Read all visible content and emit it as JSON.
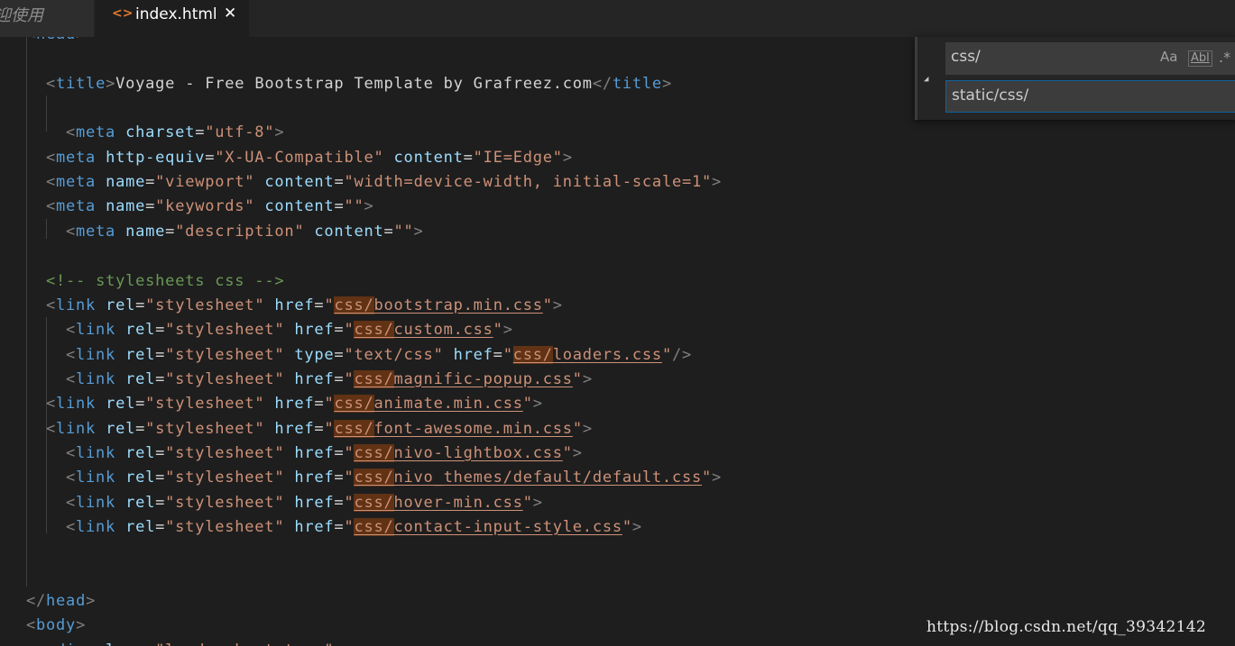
{
  "tabs": {
    "previous_label": "迎使用",
    "active": {
      "icon": "html-file-icon",
      "label": "index.html",
      "close_glyph": "✕"
    }
  },
  "colors": {
    "tag": "#569cd6",
    "attribute": "#9cdcfe",
    "string": "#ce9178",
    "comment": "#6a9955",
    "punctuation": "#808080",
    "find_match": "#613214"
  },
  "editor_lines": [
    [
      [
        "punc",
        "<"
      ],
      [
        "tag",
        "head"
      ],
      [
        "punc",
        ">"
      ]
    ],
    [],
    [
      [
        "punc",
        "<"
      ],
      [
        "tag",
        "title"
      ],
      [
        "punc",
        ">"
      ],
      [
        "plain",
        "Voyage - Free Bootstrap Template by Grafreez.com"
      ],
      [
        "punc",
        "</"
      ],
      [
        "tag",
        "title"
      ],
      [
        "punc",
        ">"
      ]
    ],
    [],
    [
      [
        "punc",
        "<"
      ],
      [
        "tag",
        "meta"
      ],
      [
        "plain",
        " "
      ],
      [
        "attr",
        "charset"
      ],
      [
        "plain",
        "="
      ],
      [
        "str",
        "\"utf-8\""
      ],
      [
        "punc",
        ">"
      ]
    ],
    [
      [
        "punc",
        "<"
      ],
      [
        "tag",
        "meta"
      ],
      [
        "plain",
        " "
      ],
      [
        "attr",
        "http-equiv"
      ],
      [
        "plain",
        "="
      ],
      [
        "str",
        "\"X-UA-Compatible\""
      ],
      [
        "plain",
        " "
      ],
      [
        "attr",
        "content"
      ],
      [
        "plain",
        "="
      ],
      [
        "str",
        "\"IE=Edge\""
      ],
      [
        "punc",
        ">"
      ]
    ],
    [
      [
        "punc",
        "<"
      ],
      [
        "tag",
        "meta"
      ],
      [
        "plain",
        " "
      ],
      [
        "attr",
        "name"
      ],
      [
        "plain",
        "="
      ],
      [
        "str",
        "\"viewport\""
      ],
      [
        "plain",
        " "
      ],
      [
        "attr",
        "content"
      ],
      [
        "plain",
        "="
      ],
      [
        "str",
        "\"width=device-width, initial-scale=1\""
      ],
      [
        "punc",
        ">"
      ]
    ],
    [
      [
        "punc",
        "<"
      ],
      [
        "tag",
        "meta"
      ],
      [
        "plain",
        " "
      ],
      [
        "attr",
        "name"
      ],
      [
        "plain",
        "="
      ],
      [
        "str",
        "\"keywords\""
      ],
      [
        "plain",
        " "
      ],
      [
        "attr",
        "content"
      ],
      [
        "plain",
        "="
      ],
      [
        "str",
        "\"\""
      ],
      [
        "punc",
        ">"
      ]
    ],
    [
      [
        "punc",
        "<"
      ],
      [
        "tag",
        "meta"
      ],
      [
        "plain",
        " "
      ],
      [
        "attr",
        "name"
      ],
      [
        "plain",
        "="
      ],
      [
        "str",
        "\"description\""
      ],
      [
        "plain",
        " "
      ],
      [
        "attr",
        "content"
      ],
      [
        "plain",
        "="
      ],
      [
        "str",
        "\"\""
      ],
      [
        "punc",
        ">"
      ]
    ],
    [],
    [
      [
        "cmt",
        "<!-- stylesheets css -->"
      ]
    ],
    [
      [
        "punc",
        "<"
      ],
      [
        "tag",
        "link"
      ],
      [
        "plain",
        " "
      ],
      [
        "attr",
        "rel"
      ],
      [
        "plain",
        "="
      ],
      [
        "str",
        "\"stylesheet\""
      ],
      [
        "plain",
        " "
      ],
      [
        "attr",
        "href"
      ],
      [
        "plain",
        "="
      ],
      [
        "str",
        "\""
      ],
      [
        "strhl",
        "css/"
      ],
      [
        "strul",
        "bootstrap.min.css"
      ],
      [
        "str",
        "\""
      ],
      [
        "punc",
        ">"
      ]
    ],
    [
      [
        "punc",
        "<"
      ],
      [
        "tag",
        "link"
      ],
      [
        "plain",
        " "
      ],
      [
        "attr",
        "rel"
      ],
      [
        "plain",
        "="
      ],
      [
        "str",
        "\"stylesheet\""
      ],
      [
        "plain",
        " "
      ],
      [
        "attr",
        "href"
      ],
      [
        "plain",
        "="
      ],
      [
        "str",
        "\""
      ],
      [
        "strhl",
        "css/"
      ],
      [
        "strul",
        "custom.css"
      ],
      [
        "str",
        "\""
      ],
      [
        "punc",
        ">"
      ]
    ],
    [
      [
        "punc",
        "<"
      ],
      [
        "tag",
        "link"
      ],
      [
        "plain",
        " "
      ],
      [
        "attr",
        "rel"
      ],
      [
        "plain",
        "="
      ],
      [
        "str",
        "\"stylesheet\""
      ],
      [
        "plain",
        " "
      ],
      [
        "attr",
        "type"
      ],
      [
        "plain",
        "="
      ],
      [
        "str",
        "\"text/css\""
      ],
      [
        "plain",
        " "
      ],
      [
        "attr",
        "href"
      ],
      [
        "plain",
        "="
      ],
      [
        "str",
        "\""
      ],
      [
        "strhl",
        "css/"
      ],
      [
        "strul",
        "loaders.css"
      ],
      [
        "str",
        "\""
      ],
      [
        "punc",
        "/>"
      ]
    ],
    [
      [
        "punc",
        "<"
      ],
      [
        "tag",
        "link"
      ],
      [
        "plain",
        " "
      ],
      [
        "attr",
        "rel"
      ],
      [
        "plain",
        "="
      ],
      [
        "str",
        "\"stylesheet\""
      ],
      [
        "plain",
        " "
      ],
      [
        "attr",
        "href"
      ],
      [
        "plain",
        "="
      ],
      [
        "str",
        "\""
      ],
      [
        "strhl",
        "css/"
      ],
      [
        "strul",
        "magnific-popup.css"
      ],
      [
        "str",
        "\""
      ],
      [
        "punc",
        ">"
      ]
    ],
    [
      [
        "punc",
        "<"
      ],
      [
        "tag",
        "link"
      ],
      [
        "plain",
        " "
      ],
      [
        "attr",
        "rel"
      ],
      [
        "plain",
        "="
      ],
      [
        "str",
        "\"stylesheet\""
      ],
      [
        "plain",
        " "
      ],
      [
        "attr",
        "href"
      ],
      [
        "plain",
        "="
      ],
      [
        "str",
        "\""
      ],
      [
        "strhl",
        "css/"
      ],
      [
        "strul",
        "animate.min.css"
      ],
      [
        "str",
        "\""
      ],
      [
        "punc",
        ">"
      ]
    ],
    [
      [
        "punc",
        "<"
      ],
      [
        "tag",
        "link"
      ],
      [
        "plain",
        " "
      ],
      [
        "attr",
        "rel"
      ],
      [
        "plain",
        "="
      ],
      [
        "str",
        "\"stylesheet\""
      ],
      [
        "plain",
        " "
      ],
      [
        "attr",
        "href"
      ],
      [
        "plain",
        "="
      ],
      [
        "str",
        "\""
      ],
      [
        "strhl",
        "css/"
      ],
      [
        "strul",
        "font-awesome.min.css"
      ],
      [
        "str",
        "\""
      ],
      [
        "punc",
        ">"
      ]
    ],
    [
      [
        "punc",
        "<"
      ],
      [
        "tag",
        "link"
      ],
      [
        "plain",
        " "
      ],
      [
        "attr",
        "rel"
      ],
      [
        "plain",
        "="
      ],
      [
        "str",
        "\"stylesheet\""
      ],
      [
        "plain",
        " "
      ],
      [
        "attr",
        "href"
      ],
      [
        "plain",
        "="
      ],
      [
        "str",
        "\""
      ],
      [
        "strhl",
        "css/"
      ],
      [
        "strul",
        "nivo-lightbox.css"
      ],
      [
        "str",
        "\""
      ],
      [
        "punc",
        ">"
      ]
    ],
    [
      [
        "punc",
        "<"
      ],
      [
        "tag",
        "link"
      ],
      [
        "plain",
        " "
      ],
      [
        "attr",
        "rel"
      ],
      [
        "plain",
        "="
      ],
      [
        "str",
        "\"stylesheet\""
      ],
      [
        "plain",
        " "
      ],
      [
        "attr",
        "href"
      ],
      [
        "plain",
        "="
      ],
      [
        "str",
        "\""
      ],
      [
        "strhl",
        "css/"
      ],
      [
        "strul",
        "nivo_themes/default/default.css"
      ],
      [
        "str",
        "\""
      ],
      [
        "punc",
        ">"
      ]
    ],
    [
      [
        "punc",
        "<"
      ],
      [
        "tag",
        "link"
      ],
      [
        "plain",
        " "
      ],
      [
        "attr",
        "rel"
      ],
      [
        "plain",
        "="
      ],
      [
        "str",
        "\"stylesheet\""
      ],
      [
        "plain",
        " "
      ],
      [
        "attr",
        "href"
      ],
      [
        "plain",
        "="
      ],
      [
        "str",
        "\""
      ],
      [
        "strhl",
        "css/"
      ],
      [
        "strul",
        "hover-min.css"
      ],
      [
        "str",
        "\""
      ],
      [
        "punc",
        ">"
      ]
    ],
    [
      [
        "punc",
        "<"
      ],
      [
        "tag",
        "link"
      ],
      [
        "plain",
        " "
      ],
      [
        "attr",
        "rel"
      ],
      [
        "plain",
        "="
      ],
      [
        "str",
        "\"stylesheet\""
      ],
      [
        "plain",
        " "
      ],
      [
        "attr",
        "href"
      ],
      [
        "plain",
        "="
      ],
      [
        "str",
        "\""
      ],
      [
        "strhl",
        "css/"
      ],
      [
        "strul",
        "contact-input-style.css"
      ],
      [
        "str",
        "\""
      ],
      [
        "punc",
        ">"
      ]
    ],
    [],
    [],
    [
      [
        "punc",
        "</"
      ],
      [
        "tag",
        "head"
      ],
      [
        "punc",
        ">"
      ]
    ],
    [
      [
        "punc",
        "<"
      ],
      [
        "tag",
        "body"
      ],
      [
        "punc",
        ">"
      ]
    ],
    [
      [
        "punc",
        "<"
      ],
      [
        "tag",
        "div"
      ],
      [
        "plain",
        " "
      ],
      [
        "attr",
        "class"
      ],
      [
        "plain",
        "="
      ],
      [
        "str",
        "\"loader-bootstrap\""
      ],
      [
        "punc",
        ">"
      ]
    ]
  ],
  "find_widget": {
    "find_value": "css/",
    "replace_value": "static/css/",
    "match_case_label": "Aa",
    "whole_word_label": "Abl",
    "regex_label": ".*",
    "toggle_glyph": "◢"
  },
  "watermark": "https://blog.csdn.net/qq_39342142"
}
